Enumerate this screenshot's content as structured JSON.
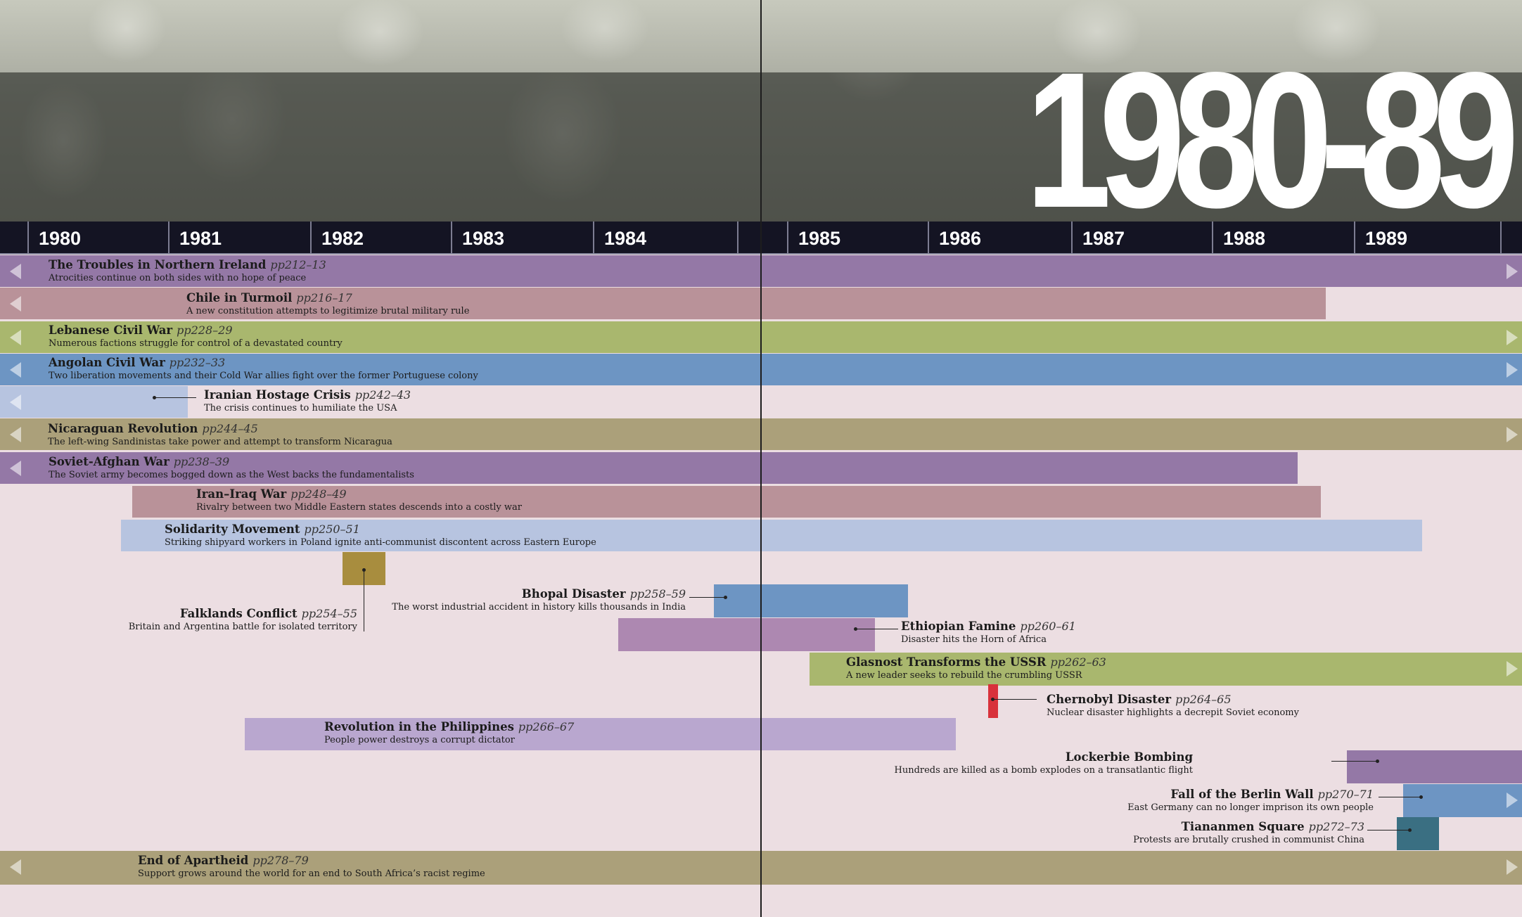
{
  "decade": "1980-89",
  "years": [
    "1980",
    "1981",
    "1982",
    "1983",
    "1984",
    "1985",
    "1986",
    "1987",
    "1988",
    "1989"
  ],
  "events": [
    {
      "title": "The Troubles in Northern Ireland",
      "pages": "pp212–13",
      "desc": "Atrocities continue on both sides with no hope of peace"
    },
    {
      "title": "Chile in Turmoil",
      "pages": "pp216–17",
      "desc": "A new constitution attempts to legitimize brutal military rule"
    },
    {
      "title": "Lebanese Civil War",
      "pages": "pp228–29",
      "desc": "Numerous factions struggle for control of a devastated country"
    },
    {
      "title": "Angolan Civil War",
      "pages": "pp232–33",
      "desc": "Two liberation movements and their Cold War allies fight over the former Portuguese colony"
    },
    {
      "title": "Iranian Hostage Crisis",
      "pages": "pp242–43",
      "desc": "The crisis continues to humiliate the USA"
    },
    {
      "title": "Nicaraguan Revolution",
      "pages": "pp244–45",
      "desc": "The left-wing Sandinistas take power and attempt to transform Nicaragua"
    },
    {
      "title": "Soviet-Afghan War",
      "pages": "pp238–39",
      "desc": "The Soviet army becomes bogged down as the West backs the fundamentalists"
    },
    {
      "title": "Iran–Iraq War",
      "pages": "pp248–49",
      "desc": "Rivalry between two Middle Eastern states descends into a costly war"
    },
    {
      "title": "Solidarity Movement",
      "pages": "pp250–51",
      "desc": "Striking shipyard workers in Poland ignite anti-communist discontent across Eastern Europe"
    },
    {
      "title": "Bhopal Disaster",
      "pages": "pp258–59",
      "desc": "The worst industrial accident in history kills thousands in India"
    },
    {
      "title": "Falklands Conflict",
      "pages": "pp254–55",
      "desc": "Britain and Argentina battle for isolated territory"
    },
    {
      "title": "Ethiopian Famine",
      "pages": "pp260–61",
      "desc": "Disaster hits the Horn of Africa"
    },
    {
      "title": "Glasnost Transforms the USSR",
      "pages": "pp262–63",
      "desc": "A new leader seeks to rebuild the crumbling USSR"
    },
    {
      "title": "Chernobyl Disaster",
      "pages": "pp264–65",
      "desc": "Nuclear disaster highlights a decrepit Soviet economy"
    },
    {
      "title": "Revolution in the Philippines",
      "pages": "pp266–67",
      "desc": "People power destroys a corrupt dictator"
    },
    {
      "title": "Lockerbie Bombing",
      "pages": "",
      "desc": "Hundreds are killed as a bomb explodes on a transatlantic flight"
    },
    {
      "title": "Fall of the Berlin Wall",
      "pages": "pp270–71",
      "desc": "East Germany can no longer imprison its own people"
    },
    {
      "title": "Tiananmen Square",
      "pages": "pp272–73",
      "desc": "Protests are brutally crushed in communist China"
    },
    {
      "title": "End of Apartheid",
      "pages": "pp278–79",
      "desc": "Support grows around the world for an end to South Africa’s racist regime"
    }
  ],
  "colors": {
    "purple": "#9478a6",
    "rose": "#b99299",
    "green": "#a9b76e",
    "blue": "#6d95c3",
    "pale_blue": "#b7c4e0",
    "olive": "#aba07a",
    "mauve": "#ad88b1",
    "lavender": "#b9a7cf",
    "ochre": "#a88d3e",
    "red": "#d8323b",
    "teal": "#3a6f82",
    "page": "#ecdee2"
  }
}
